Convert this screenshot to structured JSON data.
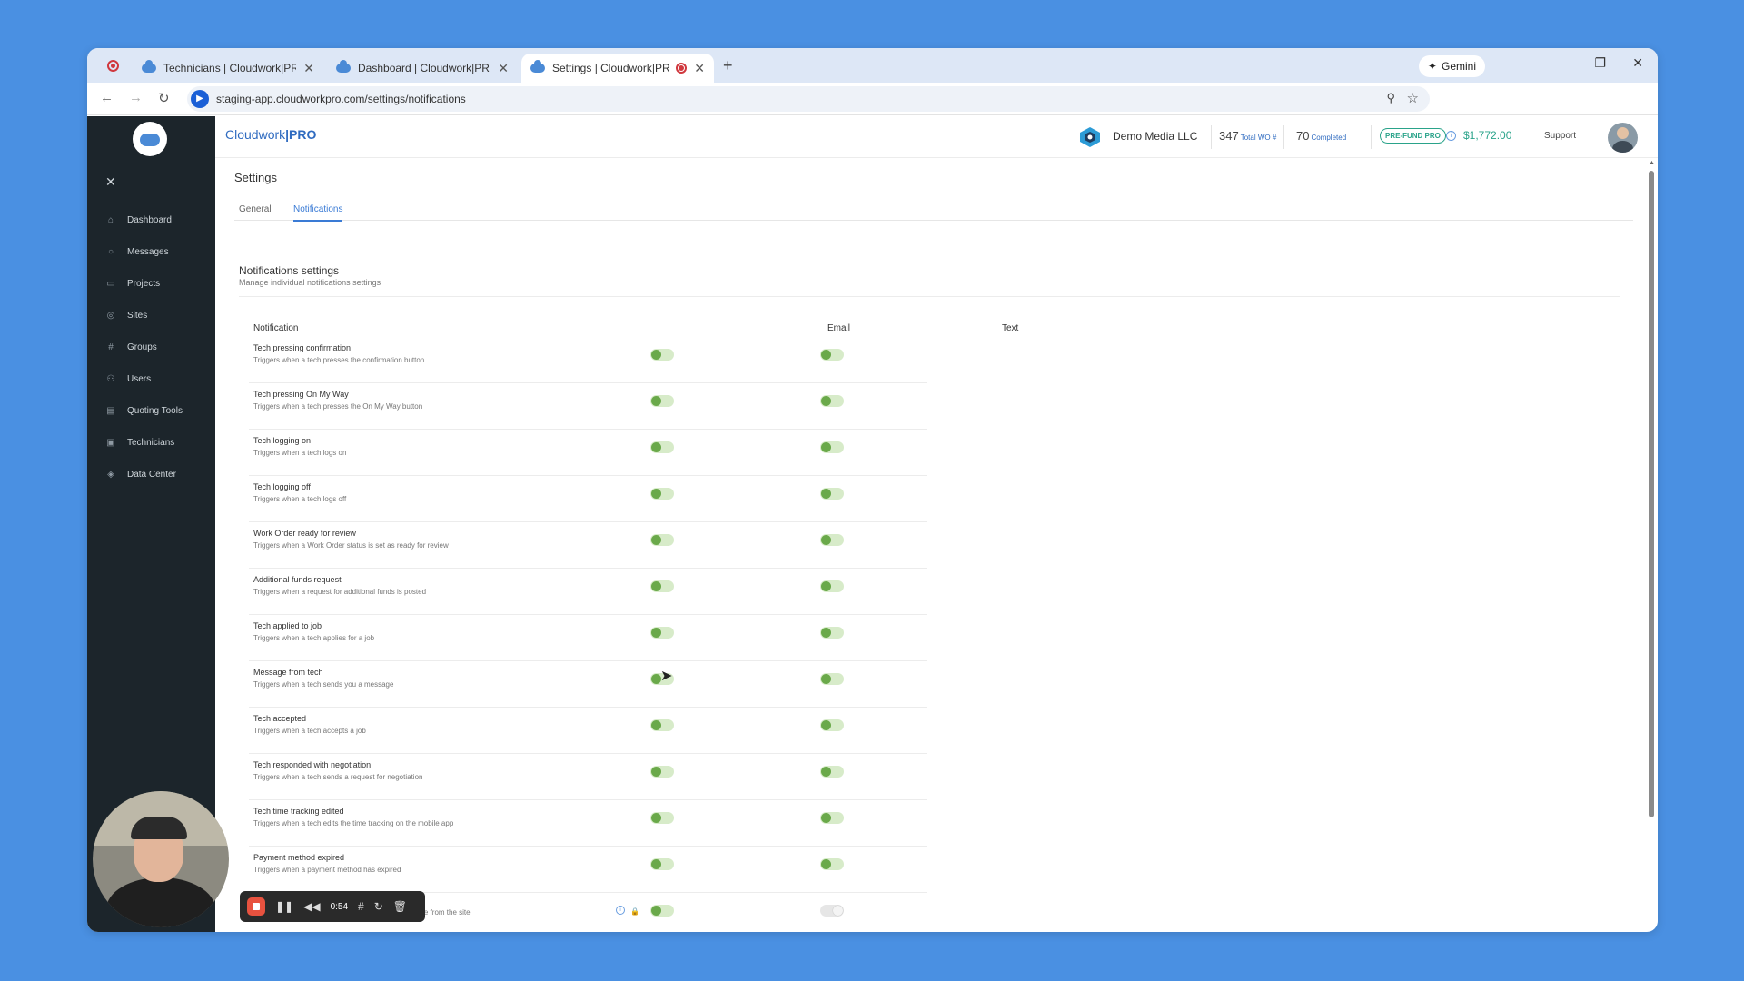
{
  "browser": {
    "tabs": [
      {
        "title": "Technicians | Cloudwork|PRO",
        "active": false
      },
      {
        "title": "Dashboard | Cloudwork|PRO",
        "active": false
      },
      {
        "title": "Settings | Cloudwork|PRO",
        "active": true
      }
    ],
    "gemini_label": "Gemini",
    "url": "staging-app.cloudworkpro.com/settings/notifications"
  },
  "sidebar": {
    "items": [
      {
        "label": "Dashboard",
        "icon": "home-icon"
      },
      {
        "label": "Messages",
        "icon": "chat-icon"
      },
      {
        "label": "Projects",
        "icon": "folder-icon"
      },
      {
        "label": "Sites",
        "icon": "location-icon"
      },
      {
        "label": "Groups",
        "icon": "hash-icon"
      },
      {
        "label": "Users",
        "icon": "users-icon"
      },
      {
        "label": "Quoting Tools",
        "icon": "clipboard-icon"
      },
      {
        "label": "Technicians",
        "icon": "id-card-icon"
      },
      {
        "label": "Data Center",
        "icon": "database-icon"
      }
    ]
  },
  "header": {
    "brand_name": "Cloudwork",
    "brand_suffix": "|PRO",
    "company": "Demo Media LLC",
    "total_wo": "347",
    "total_wo_label": "Total WO #",
    "completed": "70",
    "completed_label": "Completed",
    "badge": "PRE-FUND PRO",
    "amount": "$1,772.00",
    "support": "Support"
  },
  "page": {
    "title": "Settings",
    "tabs": [
      {
        "label": "General",
        "active": false
      },
      {
        "label": "Notifications",
        "active": true
      }
    ],
    "section_title": "Notifications settings",
    "section_subtitle": "Manage individual notifications settings",
    "columns": {
      "notification": "Notification",
      "email": "Email",
      "text": "Text"
    }
  },
  "notifications": [
    {
      "title": "Tech pressing confirmation",
      "desc": "Triggers when a tech presses the confirmation button",
      "email": true,
      "text": true
    },
    {
      "title": "Tech pressing On My Way",
      "desc": "Triggers when a tech presses the On My Way button",
      "email": true,
      "text": true
    },
    {
      "title": "Tech logging on",
      "desc": "Triggers when a tech logs on",
      "email": true,
      "text": true
    },
    {
      "title": "Tech logging off",
      "desc": "Triggers when a tech logs off",
      "email": true,
      "text": true
    },
    {
      "title": "Work Order ready for review",
      "desc": "Triggers when a Work Order status is set as ready for review",
      "email": true,
      "text": true
    },
    {
      "title": "Additional funds request",
      "desc": "Triggers when a request for additional funds is posted",
      "email": true,
      "text": true
    },
    {
      "title": "Tech applied to job",
      "desc": "Triggers when a tech applies for a job",
      "email": true,
      "text": true
    },
    {
      "title": "Message from tech",
      "desc": "Triggers when a tech sends you a message",
      "email": true,
      "text": true
    },
    {
      "title": "Tech accepted",
      "desc": "Triggers when a tech accepts a job",
      "email": true,
      "text": true
    },
    {
      "title": "Tech responded with negotiation",
      "desc": "Triggers when a tech sends a request for negotiation",
      "email": true,
      "text": true
    },
    {
      "title": "Tech time tracking edited",
      "desc": "Triggers when a tech edits the time tracking on the mobile app",
      "email": true,
      "text": true
    },
    {
      "title": "Payment method expired",
      "desc": "Triggers when a payment method has expired",
      "email": true,
      "text": true
    },
    {
      "title": "",
      "desc": "ance from the site",
      "email": true,
      "text": false,
      "locked": true
    }
  ],
  "recorder": {
    "time": "0:54"
  },
  "colors": {
    "accent": "#3a7bd5",
    "toggle_on": "#6aa94a",
    "sidebar": "#1c252b",
    "amount": "#2aa38a"
  }
}
